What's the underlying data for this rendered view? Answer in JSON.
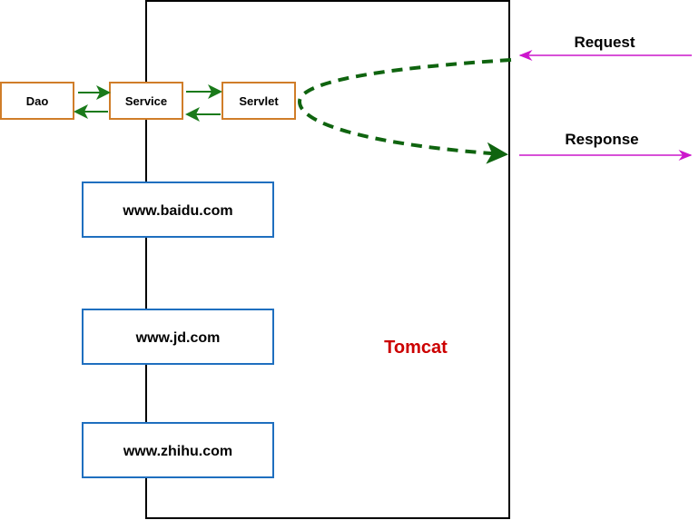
{
  "nodes": {
    "dao": "Dao",
    "service": "Service",
    "servlet": "Servlet",
    "site1": "www.baidu.com",
    "site2": "www.jd.com",
    "site3": "www.zhihu.com",
    "container": "Tomcat"
  },
  "labels": {
    "request": "Request",
    "response": "Response"
  },
  "colors": {
    "layer_box": "#d07d29",
    "site_box": "#1f6fbf",
    "inner_arrow": "#1a7a1a",
    "dashed_flow": "#0f640f",
    "http_arrow": "#cc17cc",
    "container_label": "#cc0000"
  }
}
